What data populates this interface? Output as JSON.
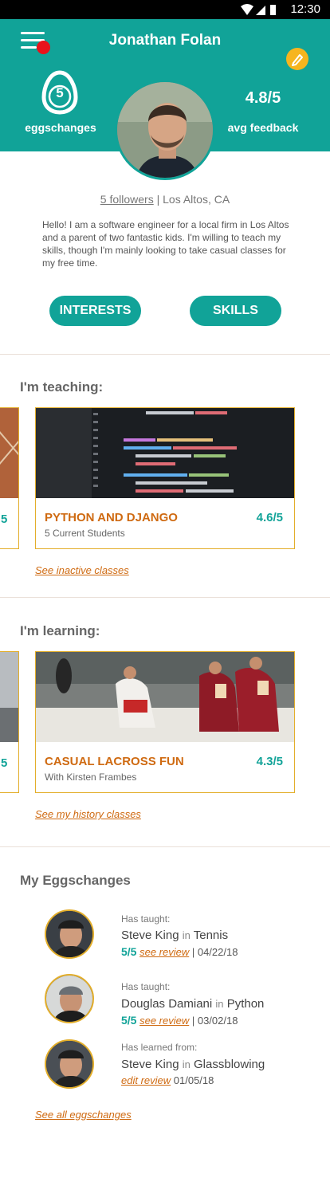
{
  "status_bar": {
    "time": "12:30"
  },
  "header": {
    "title": "Jonathan Folan",
    "eggschanges_count": "5",
    "eggschanges_label": "eggschanges",
    "avg_feedback_value": "4.8/5",
    "avg_feedback_label": "avg feedback"
  },
  "profile": {
    "followers": "5 followers",
    "location": "Los Altos, CA",
    "bio": "Hello! I am a software engineer for a local firm in Los Altos and a parent of two fantastic kids. I'm willing to teach my skills, though I'm mainly looking to take casual classes for my free time.",
    "buttons": {
      "interests": "INTERESTS",
      "skills": "SKILLS"
    }
  },
  "teaching": {
    "title": "I'm teaching:",
    "partial_rating": "5",
    "card": {
      "title": "PYTHON AND DJANGO",
      "rating": "4.6/5",
      "subtitle": "5 Current Students"
    },
    "link": "See inactive classes"
  },
  "learning": {
    "title": "I'm learning:",
    "partial_rating": "5",
    "card": {
      "title": "CASUAL LACROSS FUN",
      "rating": "4.3/5",
      "subtitle": "With Kirsten Frambes"
    },
    "link": "See my history classes"
  },
  "eggschanges": {
    "title": "My Eggschanges",
    "in_word": "in",
    "items": [
      {
        "action": "Has taught:",
        "name": "Steve King",
        "subject": "Tennis",
        "score": "5/5",
        "review_link": "see review",
        "date": "| 04/22/18"
      },
      {
        "action": "Has taught:",
        "name": "Douglas Damiani",
        "subject": "Python",
        "score": "5/5",
        "review_link": "see review",
        "date": "| 03/02/18"
      },
      {
        "action": "Has learned from:",
        "name": "Steve King",
        "subject": "Glassblowing",
        "score": "",
        "review_link": "edit review",
        "date": "01/05/18"
      }
    ],
    "link": "See all eggschanges"
  },
  "colors": {
    "teal": "#11a398",
    "orange": "#cf6a11",
    "gold": "#e3ae2a",
    "red_dot": "#e8131b"
  },
  "icons": [
    "menu-icon",
    "pencil-icon",
    "egg-icon",
    "wifi-icon",
    "signal-icon",
    "battery-icon"
  ]
}
